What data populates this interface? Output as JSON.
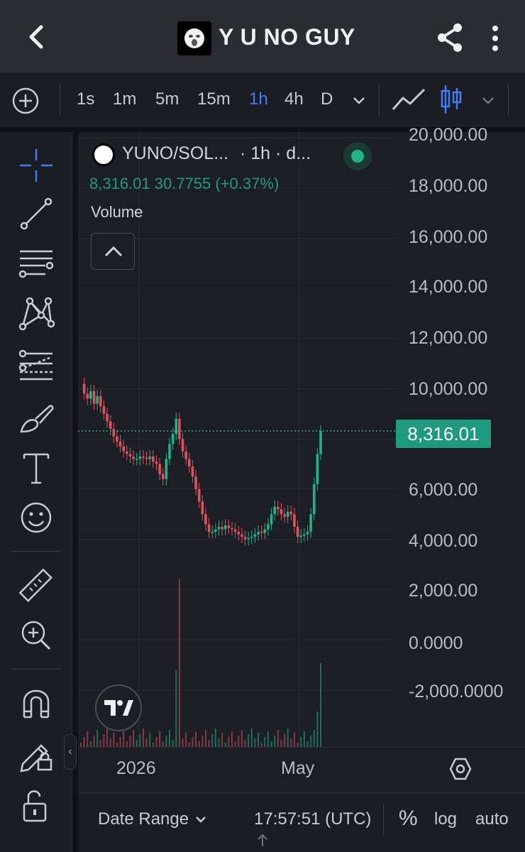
{
  "header": {
    "title": "Y U NO GUY",
    "back_icon": "back-arrow-icon",
    "share_icon": "share-icon",
    "menu_icon": "more-vertical-icon"
  },
  "toolbar": {
    "timeframes": [
      "1s",
      "1m",
      "5m",
      "15m",
      "1h",
      "4h",
      "D"
    ],
    "active_timeframe": "1h",
    "accent": "#3f7cf6"
  },
  "legend": {
    "symbol": "YUNO/SOL...",
    "interval": "· 1h · d...",
    "ohlc": "8,316.01  30.7755 (+0.37%)",
    "volume_label": "Volume",
    "status_color": "#1fb38a"
  },
  "chart_data": {
    "type": "candlestick",
    "y_ticks": [
      "20,000.00",
      "18,000.00",
      "16,000.00",
      "14,000.00",
      "12,000.00",
      "10,000.00",
      "6,000.00",
      "4,000.00",
      "2,000.00",
      "0.0000",
      "-2,000.0000"
    ],
    "ylim": [
      -2000,
      20000
    ],
    "last_price": 8316.01,
    "last_price_label": "8,316.01",
    "x_ticks": [
      "2026",
      "May"
    ],
    "series": [
      {
        "values": [
          10200,
          9800,
          9600,
          9900,
          9400,
          9700,
          9300,
          9000,
          8700,
          8400,
          8100,
          7900,
          7700,
          7500,
          7400,
          7300,
          7200,
          7200,
          7300,
          7250,
          7200,
          7300,
          7100,
          7000,
          6600,
          6400,
          7200,
          7800,
          8200,
          8800,
          8000,
          7500,
          7200,
          6900,
          6500,
          6000,
          5500,
          5000,
          4600,
          4300,
          4300,
          4400,
          4500,
          4400,
          4550,
          4450,
          4400,
          4300,
          4200,
          4100,
          4000,
          4050,
          4100,
          4200,
          4300,
          4250,
          4400,
          4600,
          5000,
          5300,
          5200,
          5000,
          4900,
          5100,
          5000,
          4500,
          4100,
          4150,
          4200,
          4300,
          5000,
          6200,
          7400,
          8316
        ]
      }
    ],
    "up_color": "#1fb38a",
    "down_color": "#e0515b"
  },
  "xaxis": {
    "labels": [
      "2026",
      "May"
    ]
  },
  "bottom": {
    "date_range": "Date Range",
    "clock": "17:57:51 (UTC)",
    "percent": "%",
    "log": "log",
    "auto": "auto"
  }
}
